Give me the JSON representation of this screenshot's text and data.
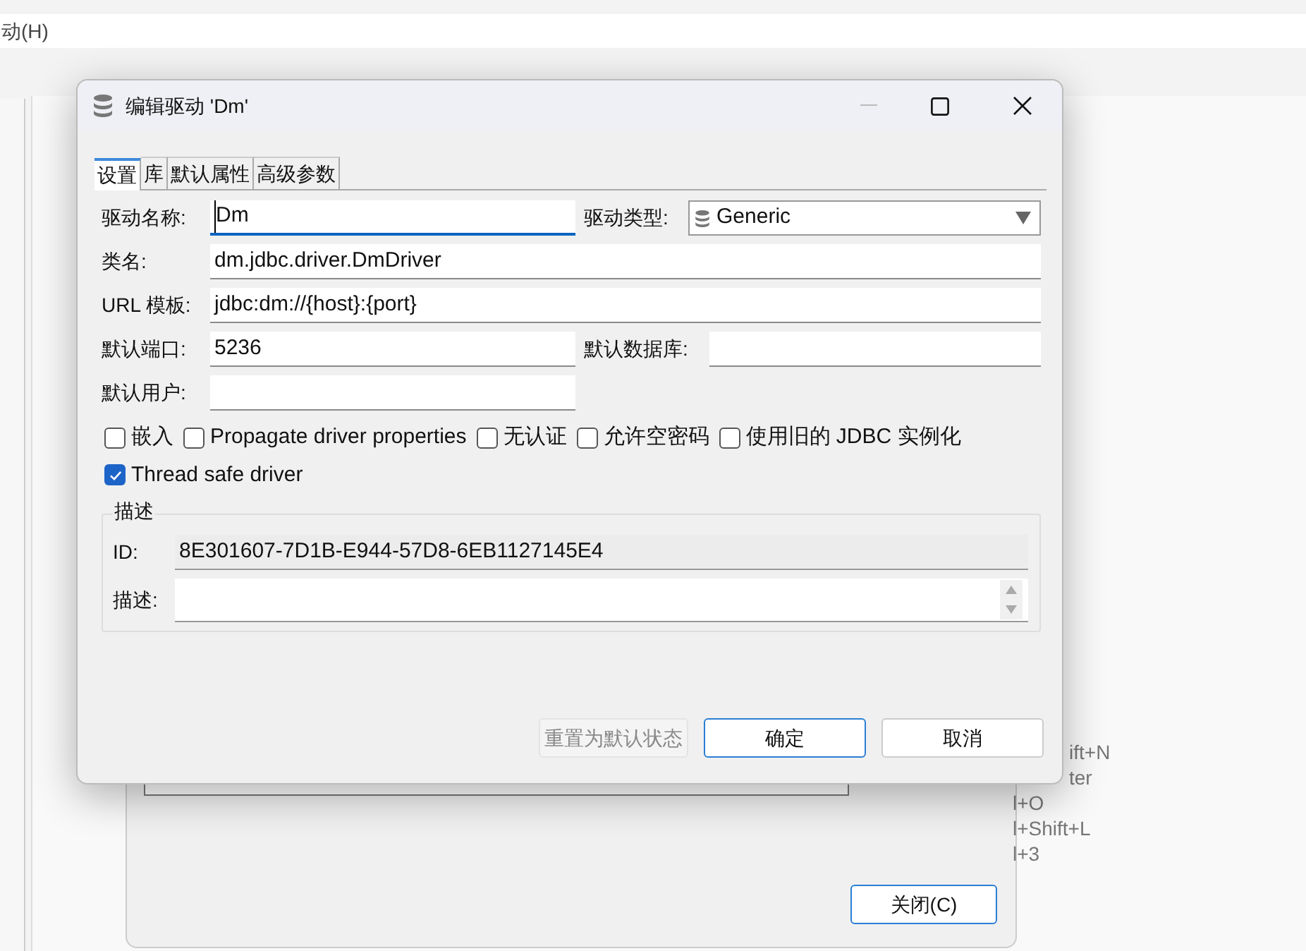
{
  "background": {
    "menu_text": "动(H)",
    "shortcuts": [
      "ift+N",
      "ter",
      "l+O",
      "l+Shift+L",
      "l+3"
    ],
    "close_button": "关闭(C)"
  },
  "dialog": {
    "title": "编辑驱动 'Dm'",
    "tabs": [
      {
        "label": "设置",
        "selected": true
      },
      {
        "label": "库",
        "selected": false
      },
      {
        "label": "默认属性",
        "selected": false
      },
      {
        "label": "高级参数",
        "selected": false
      }
    ],
    "driver_name": {
      "label": "驱动名称:",
      "value": "Dm",
      "focused": true
    },
    "driver_type": {
      "label": "驱动类型:",
      "value": "Generic"
    },
    "class_name": {
      "label": "类名:",
      "value": "dm.jdbc.driver.DmDriver"
    },
    "url_template": {
      "label": "URL 模板:",
      "value": "jdbc:dm://{host}:{port}"
    },
    "default_port": {
      "label": "默认端口:",
      "value": "5236"
    },
    "default_database": {
      "label": "默认数据库:"
    },
    "default_user": {
      "label": "默认用户:"
    },
    "checkboxes": [
      {
        "label": "嵌入",
        "checked": false
      },
      {
        "label": "Propagate driver properties",
        "checked": false
      },
      {
        "label": "无认证",
        "checked": false
      },
      {
        "label": "允许空密码",
        "checked": false
      },
      {
        "label": "使用旧的 JDBC 实例化",
        "checked": false
      },
      {
        "label": "Thread safe driver",
        "checked": true
      }
    ],
    "description": {
      "title": "描述",
      "id_label": "ID:",
      "id_value": "8E301607-7D1B-E944-57D8-6EB1127145E4",
      "desc_label": "描述:"
    },
    "buttons": [
      {
        "label": "重置为默认状态",
        "disabled": true,
        "default": false
      },
      {
        "label": "确定",
        "disabled": false,
        "default": true
      },
      {
        "label": "取消",
        "disabled": false,
        "default": false
      }
    ]
  }
}
